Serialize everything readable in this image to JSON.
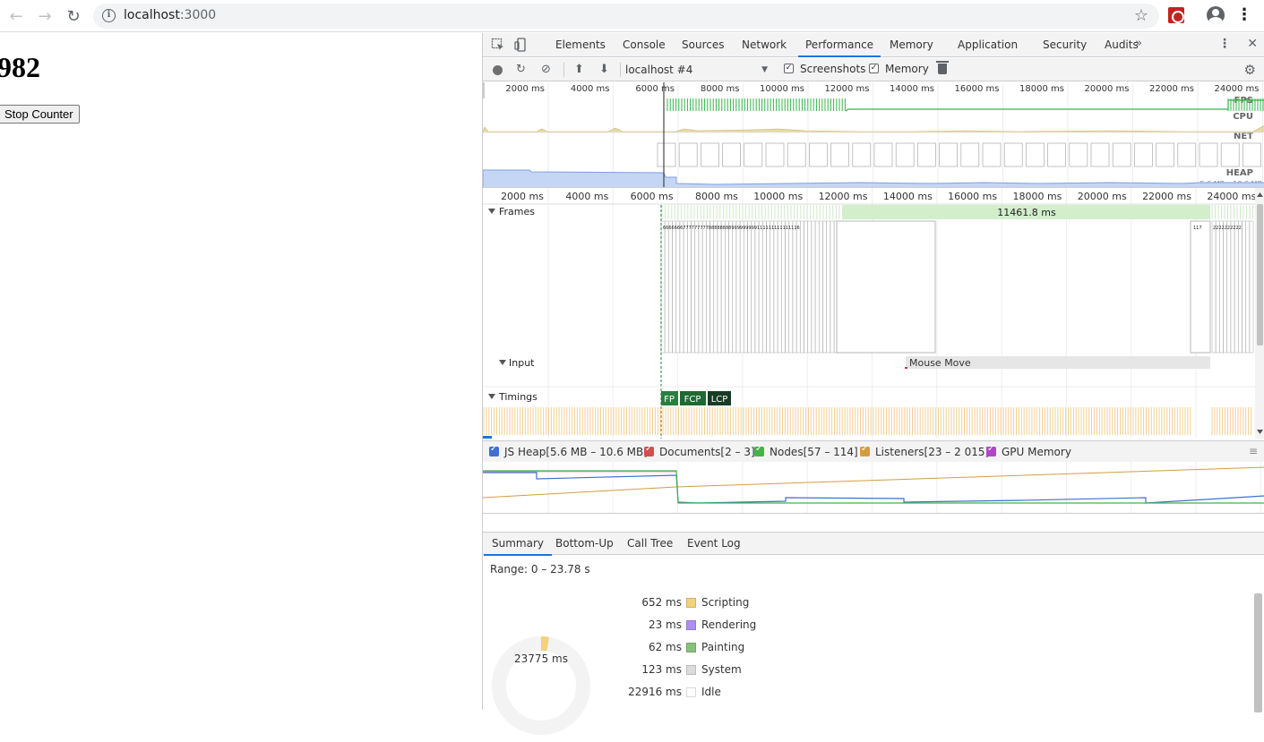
{
  "browser": {
    "url_host": "localhost",
    "url_port": ":3000",
    "icons": [
      "back-icon",
      "forward-icon",
      "reload-icon",
      "info-icon",
      "star-icon",
      "extension-icon",
      "profile-icon",
      "menu-icon"
    ]
  },
  "page": {
    "counter_value": "982",
    "stop_button_label": "Stop Counter"
  },
  "devtools": {
    "tabs": [
      {
        "label": "Elements"
      },
      {
        "label": "Console"
      },
      {
        "label": "Sources"
      },
      {
        "label": "Network"
      },
      {
        "label": "Performance",
        "active": true
      },
      {
        "label": "Memory"
      },
      {
        "label": "Application"
      },
      {
        "label": "Security"
      },
      {
        "label": "Audits"
      }
    ],
    "more_tabs_label": "»",
    "toolbar": {
      "profile_select": "localhost #4",
      "screenshots_label": "Screenshots",
      "screenshots_checked": true,
      "memory_label": "Memory",
      "memory_checked": true
    },
    "overview": {
      "ticks": [
        "2000 ms",
        "4000 ms",
        "6000 ms",
        "8000 ms",
        "10000 ms",
        "12000 ms",
        "14000 ms",
        "16000 ms",
        "18000 ms",
        "20000 ms",
        "22000 ms",
        "24000 ms"
      ],
      "lane_labels": {
        "fps": "FPS",
        "cpu": "CPU",
        "net": "NET",
        "heap": "HEAP"
      },
      "heap_range": "5.6 MB – 10.6 MB"
    },
    "timeline": {
      "ticks": [
        "2000 ms",
        "4000 ms",
        "6000 ms",
        "8000 ms",
        "10000 ms",
        "12000 ms",
        "14000 ms",
        "16000 ms",
        "18000 ms",
        "20000 ms",
        "22000 ms",
        "24000 ms"
      ],
      "frames_label": "Frames",
      "long_frame": "11461.8 ms",
      "frame_numbers_left": "666666677777777788888888999999999111111111111116",
      "frame_number_right_a": "117",
      "frame_number_right_b": "2222222222",
      "input_label": "Input",
      "mouse_move": "Mouse Move",
      "timings_label": "Timings",
      "markers": [
        {
          "label": "FP",
          "color": "#2a7f3f"
        },
        {
          "label": "FCP",
          "color": "#1e6a33"
        },
        {
          "label": "LCP",
          "color": "#173b25"
        }
      ]
    },
    "counters": [
      {
        "label": "JS Heap[5.6 MB – 10.6 MB]",
        "color": "#3f6fd1"
      },
      {
        "label": "Documents[2 – 3]",
        "color": "#d14f4f"
      },
      {
        "label": "Nodes[57 – 114]",
        "color": "#3fb44a"
      },
      {
        "label": "Listeners[23 – 2 015]",
        "color": "#d29e3c"
      },
      {
        "label": "GPU Memory",
        "color": "#b244c9"
      }
    ],
    "summary_tabs": [
      "Summary",
      "Bottom-Up",
      "Call Tree",
      "Event Log"
    ],
    "summary": {
      "range": "Range: 0 – 23.78 s",
      "total": "23775 ms",
      "rows": [
        {
          "value": "652 ms",
          "label": "Scripting",
          "color": "#f2d27a"
        },
        {
          "value": "23 ms",
          "label": "Rendering",
          "color": "#ad8ef0"
        },
        {
          "value": "62 ms",
          "label": "Painting",
          "color": "#85c27b"
        },
        {
          "value": "123 ms",
          "label": "System",
          "color": "#dcdcdc"
        },
        {
          "value": "22916 ms",
          "label": "Idle",
          "color": "#ffffff"
        }
      ]
    }
  }
}
